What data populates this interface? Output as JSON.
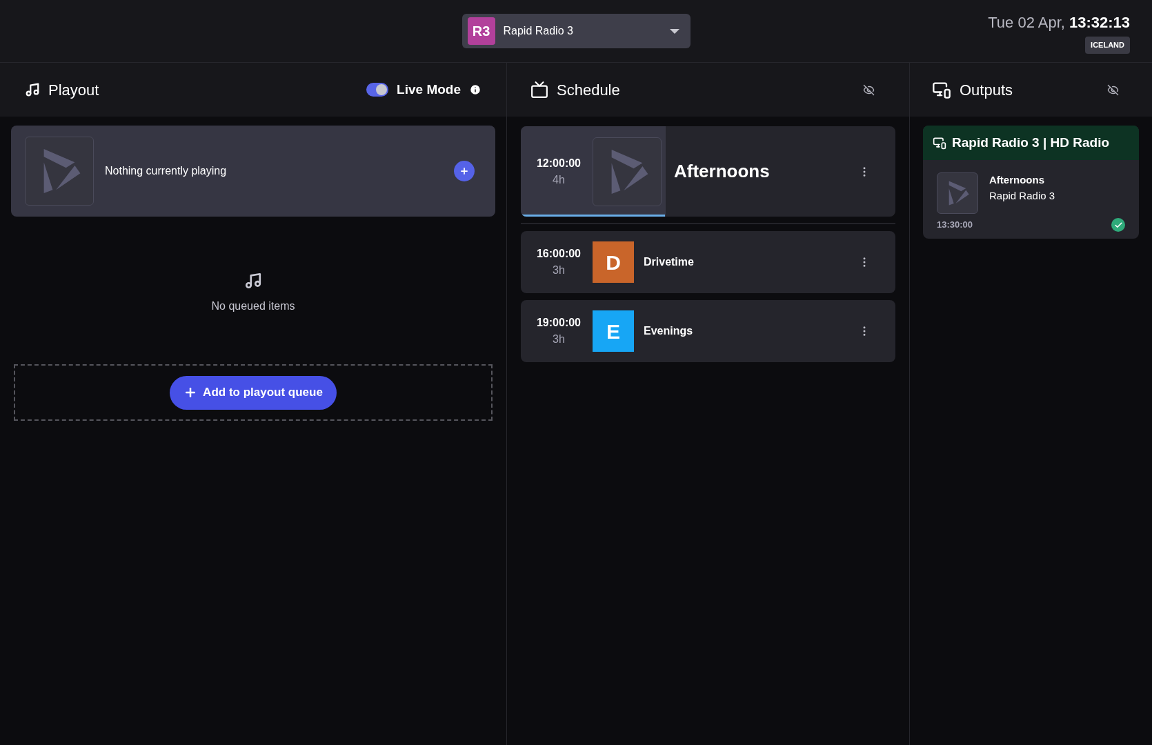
{
  "station_picker": {
    "badge": "R3",
    "color": "#b2409b",
    "name": "Rapid Radio 3"
  },
  "clock": {
    "date": "Tue 02 Apr,",
    "time": "13:32:13",
    "timezone": "ICELAND"
  },
  "playout": {
    "title": "Playout",
    "live_mode": {
      "label": "Live Mode",
      "on": true
    },
    "now_playing": "Nothing currently playing",
    "empty_text": "No queued items",
    "add_button": "Add to playout queue"
  },
  "schedule": {
    "title": "Schedule",
    "items": [
      {
        "start": "12:00:00",
        "duration": "4h",
        "title": "Afternoons",
        "current": true,
        "level": 0.385
      },
      {
        "start": "16:00:00",
        "duration": "3h",
        "title": "Drivetime",
        "current": false,
        "letter": "D",
        "color": "#c9652a"
      },
      {
        "start": "19:00:00",
        "duration": "3h",
        "title": "Evenings",
        "current": false,
        "letter": "E",
        "color": "#17a6f5"
      }
    ]
  },
  "outputs": {
    "title": "Outputs",
    "items": [
      {
        "name": "Rapid Radio 3 | HD Radio",
        "title": "Afternoons",
        "station": "Rapid Radio 3",
        "time": "13:30:00",
        "ok": true
      }
    ]
  }
}
